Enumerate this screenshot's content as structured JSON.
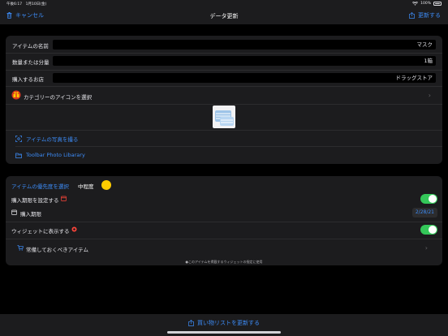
{
  "status_bar": {
    "time": "午後6:17　1月10日(金)",
    "battery": "100%"
  },
  "nav": {
    "cancel_label": "キャンセル",
    "title": "データ更新",
    "update_label": "更新する"
  },
  "fields": [
    {
      "label": "アイテムの名前",
      "value": "マスク"
    },
    {
      "label": "数量または分量",
      "value": "1箱"
    },
    {
      "label": "購入するお店",
      "value": "ドラッグストア"
    }
  ],
  "category": {
    "label": "カテゴリーのアイコンを選択"
  },
  "photo_actions": {
    "take_photo": "アイテムの写真を撮る",
    "library": "Toolbar Photo Libarary"
  },
  "priority": {
    "label": "アイテムの優先度を選択",
    "value": "中程度",
    "color": "#ffcc00"
  },
  "deadline": {
    "toggle_label": "購入期限を設定する",
    "enabled": true,
    "date_label": "購入期限",
    "date_value": "2/28/21"
  },
  "widget": {
    "label": "ウィジェットに表示する",
    "enabled": true
  },
  "stock": {
    "label": "常備しておくべきアイテム"
  },
  "footnote": "●このアイテムを掲載するウィジェットの指定に使用",
  "bottom": {
    "action_label": "買い物リストを更新する"
  },
  "colors": {
    "accent": "#3d8cf7",
    "toggle_on": "#34c759",
    "background": "#000000",
    "card": "#1c1c1e"
  }
}
